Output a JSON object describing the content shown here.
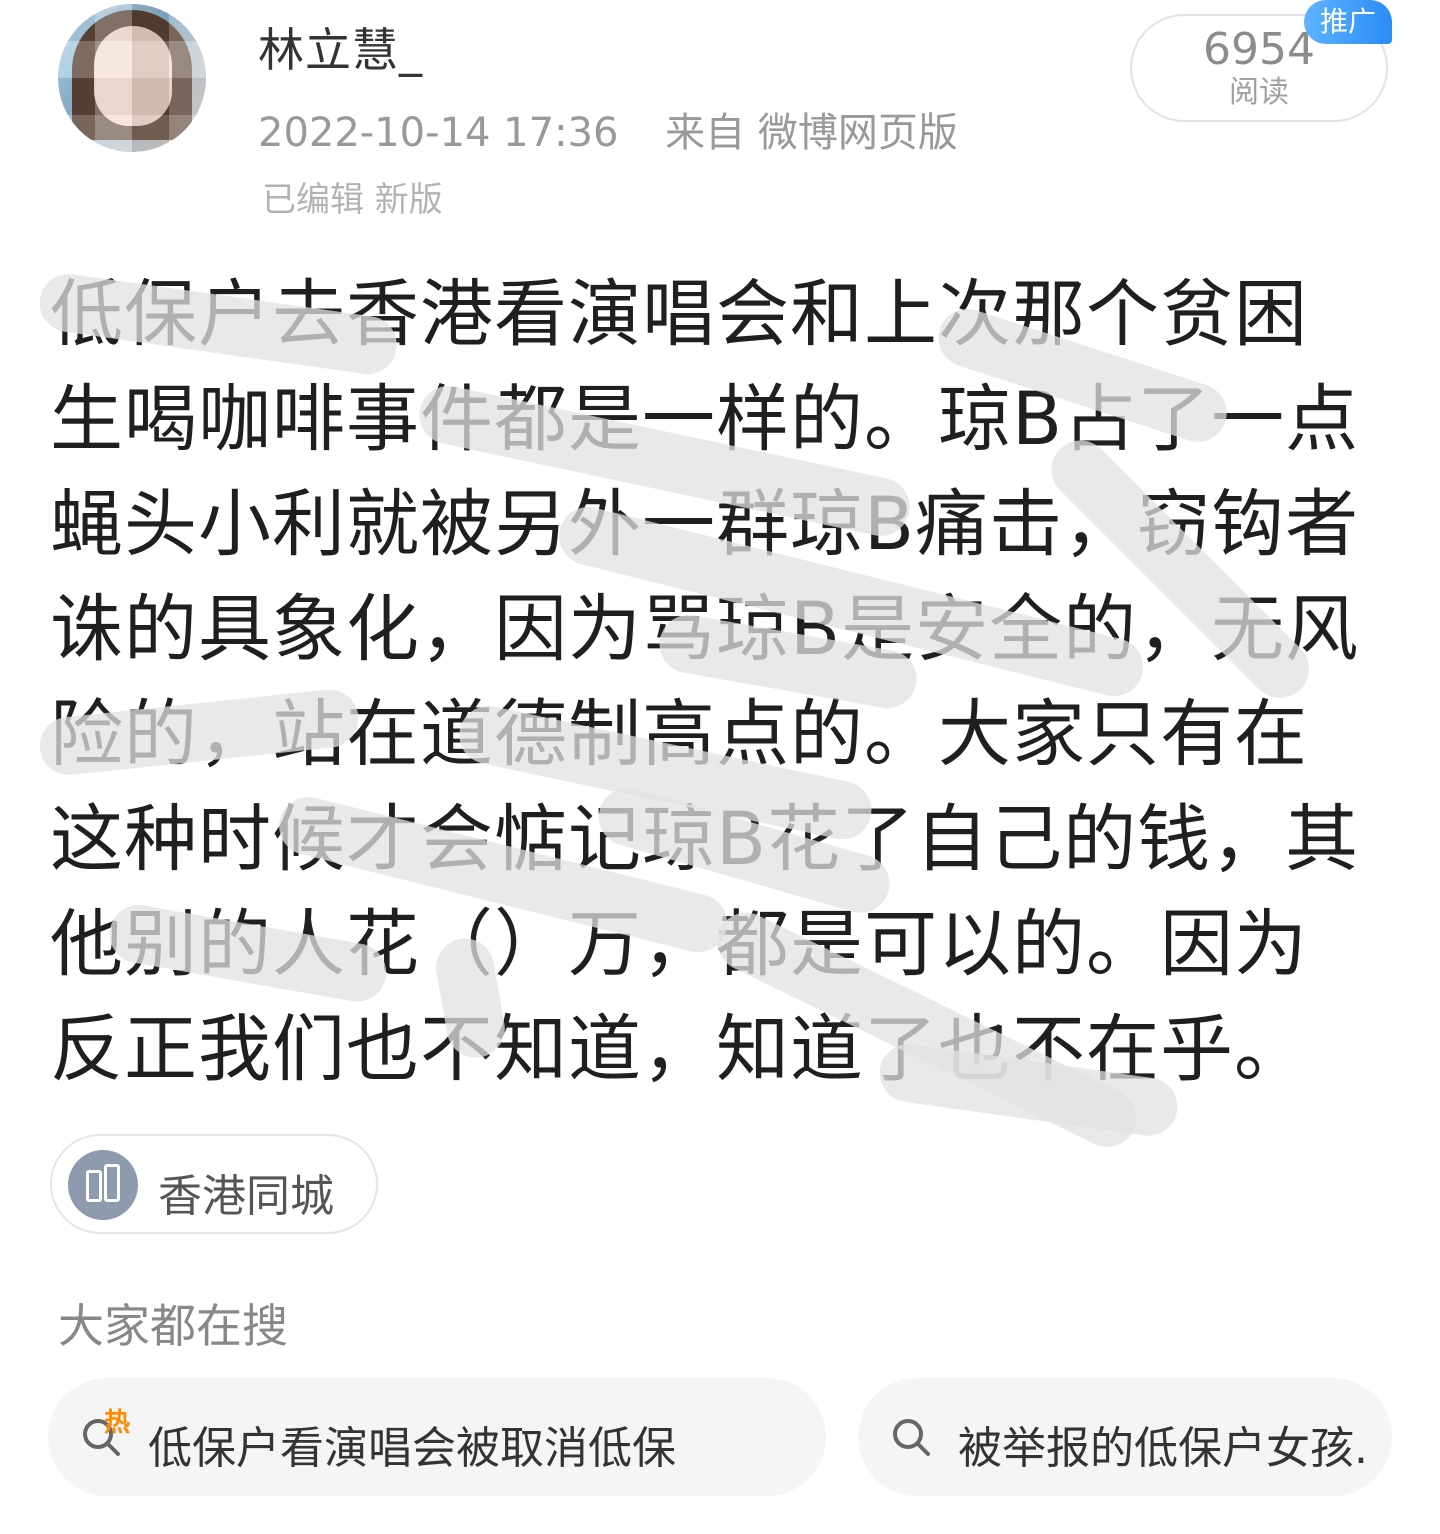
{
  "header": {
    "username": "林立慧_",
    "time": "2022-10-14 17:36",
    "source": "来自 微博网页版",
    "subline": "已编辑 新版"
  },
  "stats": {
    "read_count": "6954",
    "read_label": "阅读",
    "promo_tag": "推广"
  },
  "post": {
    "lines": [
      "低保户去香港看演唱会和上次那个贫困",
      "生喝咖啡事件都是一样的。琼B占了一点",
      "蝇头小利就被另外一群琼B痛击，窃钩者",
      "诛的具象化，因为骂琼B是安全的，无风",
      "险的，站在道德制高点的。大家只有在",
      "这种时候才会惦记琼B花了自己的钱，其",
      "他别的人花（）万，都是可以的。因为",
      "反正我们也不知道，知道了也不在乎。"
    ]
  },
  "location": {
    "label": "香港同城",
    "icon": "building-icon"
  },
  "hot_search": {
    "title": "大家都在搜",
    "items": [
      {
        "label": "低保户看演唱会被取消低保",
        "tag": "热",
        "icon": "hot-search-icon"
      },
      {
        "label": "被举报的低保户女孩...",
        "icon": "search-icon"
      }
    ]
  },
  "colors": {
    "promo_blue": "#2b8cf5",
    "meta_gray": "#999999",
    "hot_orange": "#ff8a00"
  }
}
